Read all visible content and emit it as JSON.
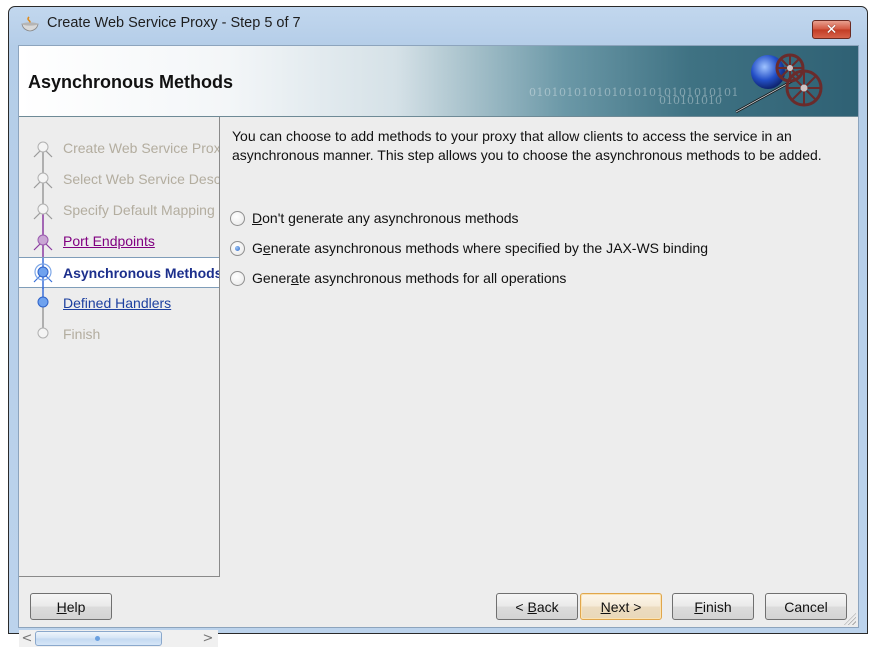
{
  "window": {
    "title": "Create Web Service Proxy - Step 5 of 7",
    "close_label": "✕"
  },
  "header": {
    "title": "Asynchronous Methods",
    "binary_text_1": "0101010101010101010101010101",
    "binary_text_2": "010101010"
  },
  "sidebar": {
    "steps": [
      {
        "label": "Create Web Service Proxy",
        "state": "disabled"
      },
      {
        "label": "Select Web Service Description",
        "state": "disabled"
      },
      {
        "label": "Specify Default Mapping Options",
        "state": "disabled"
      },
      {
        "label": "Port Endpoints",
        "state": "visited"
      },
      {
        "label": "Asynchronous Methods",
        "state": "current"
      },
      {
        "label": "Defined Handlers",
        "state": "link"
      },
      {
        "label": "Finish",
        "state": "disabled"
      }
    ],
    "scroll_left": "<",
    "scroll_right": ">"
  },
  "content": {
    "description": "You can choose to add methods to your proxy that allow clients to access the service in an asynchronous manner. This step allows you to choose the asynchronous methods to be added.",
    "options": [
      {
        "pre": "",
        "mnemonic": "D",
        "post": "on't generate any asynchronous methods",
        "checked": false
      },
      {
        "pre": "G",
        "mnemonic": "e",
        "post": "nerate asynchronous methods where specified by the JAX-WS binding",
        "checked": true
      },
      {
        "pre": "Gener",
        "mnemonic": "a",
        "post": "te asynchronous methods for all operations",
        "checked": false
      }
    ]
  },
  "buttons": {
    "help": {
      "pre": "",
      "mnemonic": "H",
      "post": "elp"
    },
    "back": {
      "pre": "< ",
      "mnemonic": "B",
      "post": "ack"
    },
    "next": {
      "pre": "",
      "mnemonic": "N",
      "post": "ext >"
    },
    "finish": {
      "pre": "",
      "mnemonic": "F",
      "post": "inish"
    },
    "cancel": {
      "pre": "",
      "mnemonic": "",
      "post": "Cancel"
    }
  },
  "colors": {
    "link": "#1c3f9f",
    "visited": "#800080",
    "disabled": "#b3ad9f",
    "current": "#1c2f8c",
    "default_button_border": "#e0a64c"
  }
}
